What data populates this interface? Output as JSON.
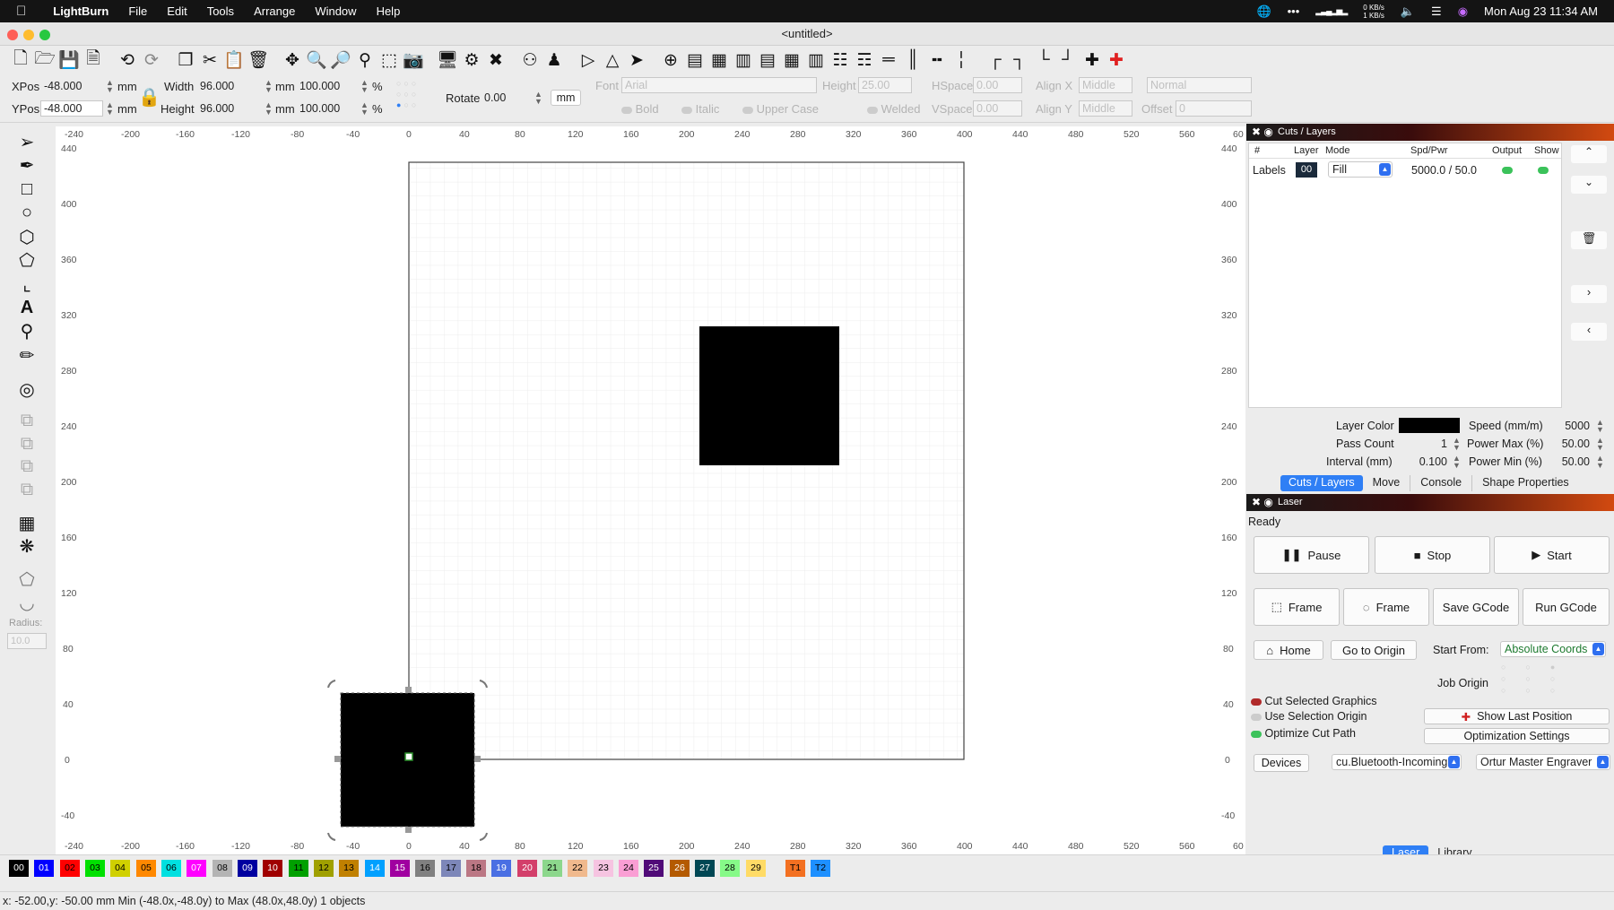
{
  "menubar": {
    "app": "LightBurn",
    "items": [
      "File",
      "Edit",
      "Tools",
      "Arrange",
      "Window",
      "Help"
    ],
    "net_up": "0 KB/s",
    "net_down": "1 KB/s",
    "datetime": "Mon Aug 23  11:34 AM"
  },
  "window": {
    "title": "<untitled>"
  },
  "props": {
    "xpos_label": "XPos",
    "xpos": "-48.000",
    "ypos_label": "YPos",
    "ypos": "-48.000",
    "mm": "mm",
    "width_label": "Width",
    "width": "96.000",
    "height_label": "Height",
    "height": "96.000",
    "pct_w": "100.000",
    "pct_h": "100.000",
    "pct": "%",
    "rotate_label": "Rotate",
    "rotate": "0.00",
    "rotate_unit": "mm",
    "font_label": "Font",
    "font_value": "Arial",
    "text_height_label": "Height",
    "text_height": "25.00",
    "hspace_label": "HSpace",
    "hspace": "0.00",
    "align_x_label": "Align X",
    "align_x": "Middle",
    "normal": "Normal",
    "bold": "Bold",
    "italic": "Italic",
    "upper_case": "Upper Case",
    "welded": "Welded",
    "vspace_label": "VSpace",
    "vspace": "0.00",
    "align_y_label": "Align Y",
    "align_y": "Middle",
    "offset_label": "Offset",
    "offset": "0"
  },
  "left_tools": {
    "radius_label": "Radius:",
    "radius_value": "10.0"
  },
  "ruler": {
    "x_labels": [
      "-240",
      "-200",
      "-160",
      "-120",
      "-80",
      "-40",
      "0",
      "40",
      "80",
      "120",
      "160",
      "200",
      "240",
      "280",
      "320",
      "360",
      "400",
      "440",
      "480",
      "520",
      "560",
      "60"
    ],
    "y_labels": [
      "440",
      "400",
      "360",
      "320",
      "280",
      "240",
      "200",
      "160",
      "120",
      "80",
      "40",
      "0",
      "-40"
    ]
  },
  "cuts_layers": {
    "title": "Cuts / Layers",
    "columns": [
      "#",
      "Layer",
      "Mode",
      "Spd/Pwr",
      "Output",
      "Show"
    ],
    "row": {
      "name": "Labels",
      "layer": "00",
      "mode": "Fill",
      "spdpwr": "5000.0 / 50.0"
    },
    "layer_color_label": "Layer Color",
    "layer_color": "#000000",
    "pass_count_label": "Pass Count",
    "pass_count": "1",
    "interval_label": "Interval (mm)",
    "interval": "0.100",
    "speed_label": "Speed (mm/m)",
    "speed": "5000",
    "power_max_label": "Power Max (%)",
    "power_max": "50.00",
    "power_min_label": "Power Min (%)",
    "power_min": "50.00",
    "tabs": [
      "Cuts / Layers",
      "Move",
      "Console",
      "Shape Properties"
    ]
  },
  "laser": {
    "title": "Laser",
    "status": "Ready",
    "pause": "Pause",
    "stop": "Stop",
    "start": "Start",
    "frame1": "Frame",
    "frame2": "Frame",
    "save_gcode": "Save GCode",
    "run_gcode": "Run GCode",
    "home": "Home",
    "go_to_origin": "Go to Origin",
    "start_from_label": "Start From:",
    "start_from": "Absolute Coords",
    "job_origin": "Job Origin",
    "cut_selected": "Cut Selected Graphics",
    "use_selection_origin": "Use Selection Origin",
    "optimize_cut": "Optimize Cut Path",
    "show_last_position": "Show Last Position",
    "optimization_settings": "Optimization Settings",
    "devices": "Devices",
    "port": "cu.Bluetooth-Incoming",
    "device": "Ortur Master Engraver",
    "bottom_tabs": [
      "Laser",
      "Library"
    ]
  },
  "palette": [
    {
      "label": "00",
      "color": "#000000",
      "fg": "#ffffff"
    },
    {
      "label": "01",
      "color": "#0000ff",
      "fg": "#ffffff"
    },
    {
      "label": "02",
      "color": "#ff0000",
      "fg": "#000000"
    },
    {
      "label": "03",
      "color": "#00e000",
      "fg": "#000000"
    },
    {
      "label": "04",
      "color": "#d0d000",
      "fg": "#000000"
    },
    {
      "label": "05",
      "color": "#ff8800",
      "fg": "#000000"
    },
    {
      "label": "06",
      "color": "#00e0e0",
      "fg": "#000000"
    },
    {
      "label": "07",
      "color": "#ff00ff",
      "fg": "#ffffff"
    },
    {
      "label": "08",
      "color": "#b4b4b4",
      "fg": "#000000"
    },
    {
      "label": "09",
      "color": "#0000a0",
      "fg": "#ffffff"
    },
    {
      "label": "10",
      "color": "#a00000",
      "fg": "#ffffff"
    },
    {
      "label": "11",
      "color": "#00a000",
      "fg": "#000000"
    },
    {
      "label": "12",
      "color": "#a0a000",
      "fg": "#000000"
    },
    {
      "label": "13",
      "color": "#c08000",
      "fg": "#000000"
    },
    {
      "label": "14",
      "color": "#00a0ff",
      "fg": "#ffffff"
    },
    {
      "label": "15",
      "color": "#a000a0",
      "fg": "#ffffff"
    },
    {
      "label": "16",
      "color": "#808080",
      "fg": "#000000"
    },
    {
      "label": "17",
      "color": "#7d87b9",
      "fg": "#000000"
    },
    {
      "label": "18",
      "color": "#bb7784",
      "fg": "#000000"
    },
    {
      "label": "19",
      "color": "#4a6fe3",
      "fg": "#ffffff"
    },
    {
      "label": "20",
      "color": "#d33f6a",
      "fg": "#ffffff"
    },
    {
      "label": "21",
      "color": "#8cd78c",
      "fg": "#000000"
    },
    {
      "label": "22",
      "color": "#f0b98d",
      "fg": "#000000"
    },
    {
      "label": "23",
      "color": "#f6c4e1",
      "fg": "#000000"
    },
    {
      "label": "24",
      "color": "#fa9ed4",
      "fg": "#000000"
    },
    {
      "label": "25",
      "color": "#500a78",
      "fg": "#ffffff"
    },
    {
      "label": "26",
      "color": "#b45a00",
      "fg": "#ffffff"
    },
    {
      "label": "27",
      "color": "#004754",
      "fg": "#ffffff"
    },
    {
      "label": "28",
      "color": "#86fa88",
      "fg": "#000000"
    },
    {
      "label": "29",
      "color": "#ffdb66",
      "fg": "#000000"
    },
    {
      "label": "T1",
      "color": "#f37021",
      "fg": "#000000"
    },
    {
      "label": "T2",
      "color": "#1e90ff",
      "fg": "#000000"
    }
  ],
  "status": {
    "text": "x: -52.00,y: -50.00 mm    Min (-48.0x,-48.0y) to Max (48.0x,48.0y)  1 objects"
  }
}
